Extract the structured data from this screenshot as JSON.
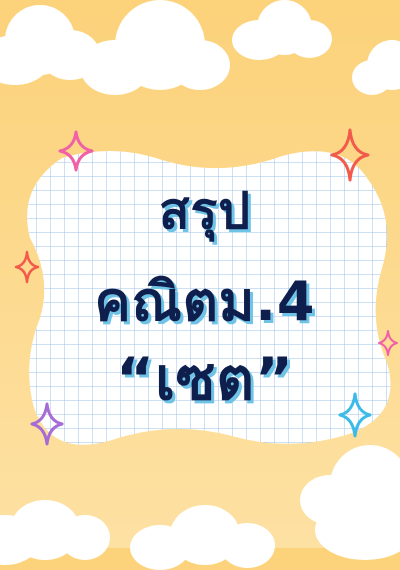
{
  "cover": {
    "line1": "สรุป",
    "line2": "คณิตม.4",
    "line3": "“เซต”"
  },
  "colors": {
    "background": "#fcd27a",
    "cloud": "#ffffff",
    "paper": "#ffffff",
    "grid": "#9cc2ea",
    "title": "#0f1f4d",
    "title_shadow": "#6ec3e6",
    "sparkle_pink": "#f15fa6",
    "sparkle_red": "#f25b4b",
    "sparkle_blue": "#3dbbe8",
    "sparkle_purple": "#a76bd6"
  },
  "icons": [
    "cloud-icon",
    "sparkle-icon"
  ]
}
